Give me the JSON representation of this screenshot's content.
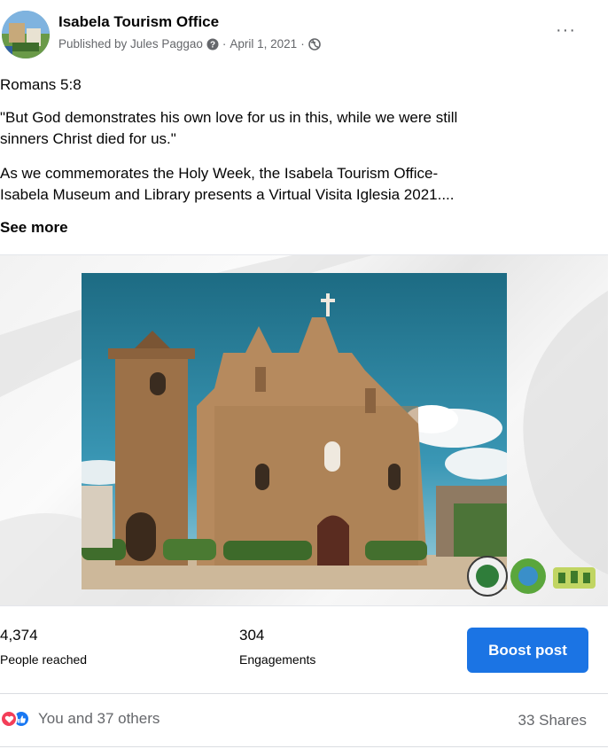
{
  "post": {
    "page_name": "Isabela Tourism Office",
    "publisher": "Published by Jules Paggao",
    "separator": "·",
    "date": "April 1, 2021",
    "more_label": "···",
    "verse_ref": "Romans 5:8",
    "quote_line1": "\"But God demonstrates his own love for us in this, while we were still",
    "quote_line2": "sinners Christ died for us.\"",
    "body_line1": "As we commemorates the Holy Week, the Isabela Tourism Office-",
    "body_line2": "Isabela Museum and Library presents a Virtual Visita Iglesia 2021....",
    "see_more": "See more",
    "icons": {
      "publisher_icon": "help-circle-icon",
      "audience_icon": "globe-icon",
      "more_icon": "more-icon"
    }
  },
  "stats": {
    "reached_value": "4,374",
    "reached_label": "People reached",
    "engagements_value": "304",
    "engagements_label": "Engagements",
    "boost_label": "Boost post"
  },
  "reactions": {
    "summary": "You and 37 others",
    "shares": "33 Shares",
    "icons": [
      "love-reaction-icon",
      "like-reaction-icon"
    ]
  },
  "colors": {
    "primary": "#1b74e4",
    "text": "#050505",
    "secondary_text": "#65676b",
    "love": "#f33e58",
    "like": "#1877f2"
  }
}
